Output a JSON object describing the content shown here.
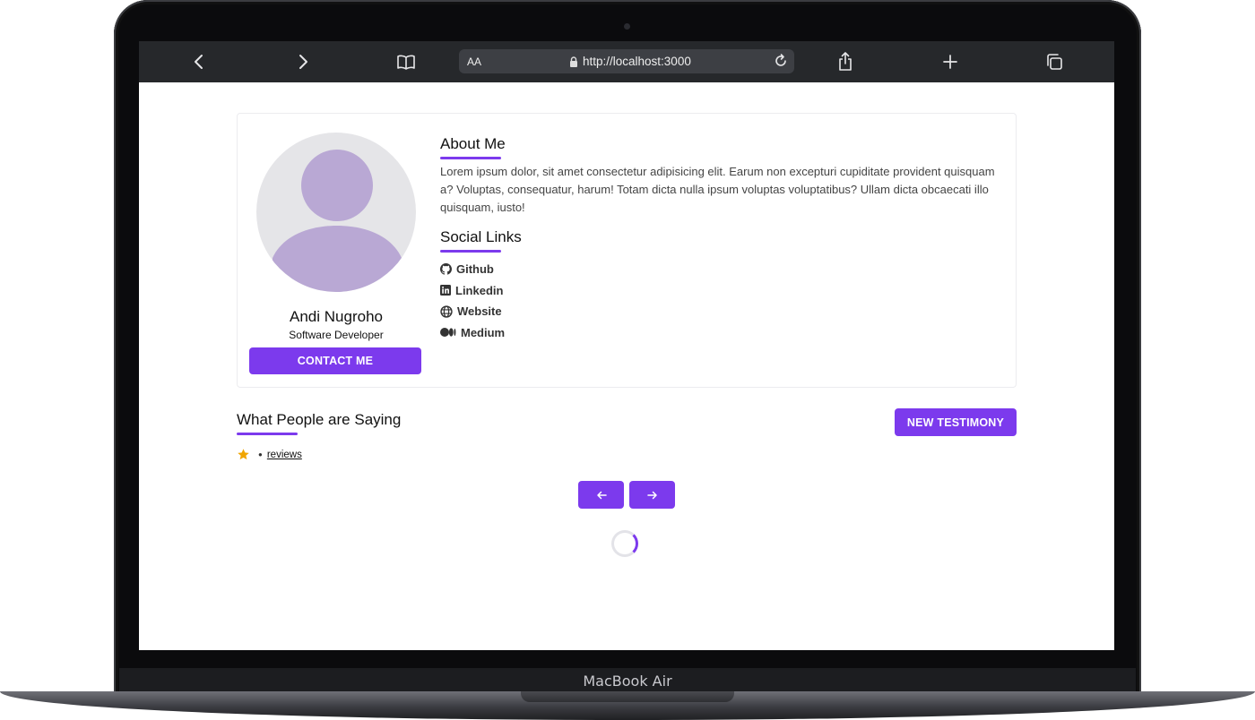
{
  "device": {
    "label": "MacBook Air"
  },
  "browser": {
    "text_size_label": "AA",
    "url": "http://localhost:3000"
  },
  "profile": {
    "name": "Andi Nugroho",
    "role": "Software Developer",
    "contact_button": "CONTACT ME"
  },
  "about": {
    "heading": "About Me",
    "text": "Lorem ipsum dolor, sit amet consectetur adipisicing elit. Earum non excepturi cupiditate provident quisquam a? Voluptas, consequatur, harum! Totam dicta nulla ipsum voluptas voluptatibus? Ullam dicta obcaecati illo quisquam, iusto!"
  },
  "social": {
    "heading": "Social Links",
    "links": [
      {
        "label": "Github",
        "icon": "github-icon"
      },
      {
        "label": "Linkedin",
        "icon": "linkedin-icon"
      },
      {
        "label": "Website",
        "icon": "globe-icon"
      },
      {
        "label": "Medium",
        "icon": "medium-icon"
      }
    ]
  },
  "testimonials": {
    "heading": "What People are Saying",
    "new_button": "NEW TESTIMONY",
    "reviews_label": "reviews",
    "star_icon": "star-icon",
    "prev_icon": "arrow-left-icon",
    "next_icon": "arrow-right-icon"
  },
  "colors": {
    "accent": "#7c3aed",
    "avatar_figure": "#b9a8d4",
    "star": "#f0a500"
  }
}
